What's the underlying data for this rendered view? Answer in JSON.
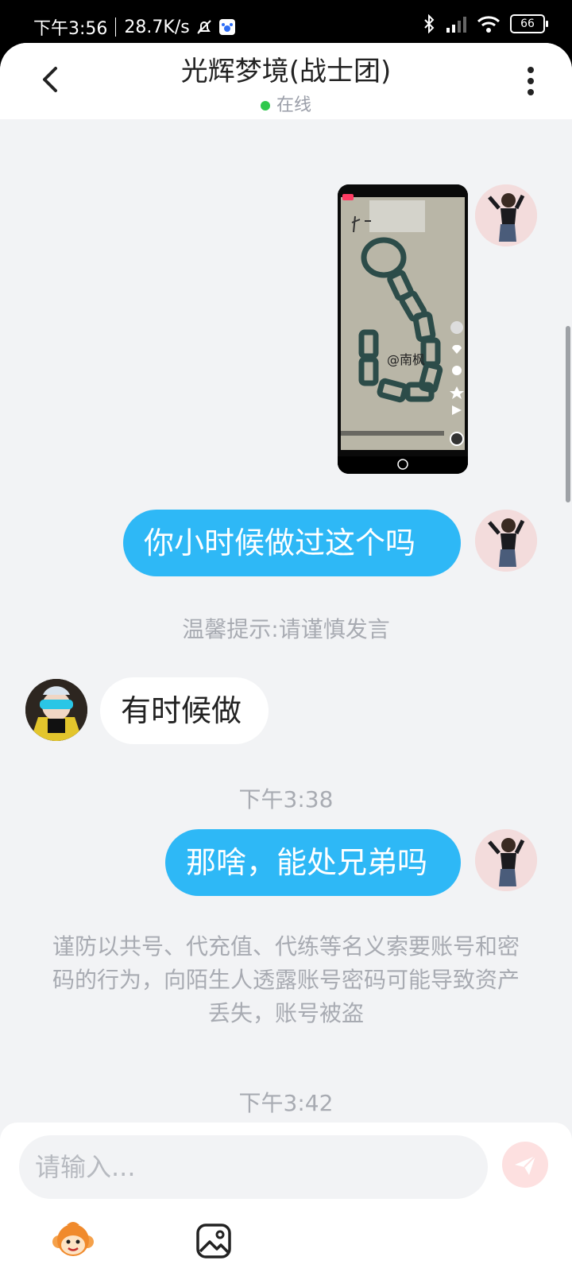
{
  "status_bar": {
    "time": "下午3:56",
    "speed": "28.7K/s",
    "battery": "66"
  },
  "header": {
    "title": "光辉梦境(战士团)",
    "status": "在线"
  },
  "messages": {
    "video_caption_user": "@一棵南枫",
    "msg1": "你小时候做过这个吗",
    "tip1": "温馨提示:请谨慎发言",
    "msg2": "有时候做",
    "time1": "下午3:38",
    "msg3": "那啥，能处兄弟吗",
    "notice": "谨防以共号、代充值、代练等名义索要账号和密码的行为，向陌生人透露账号密码可能导致资产丢失，账号被盗",
    "time2": "下午3:42"
  },
  "composer": {
    "placeholder": "请输入..."
  },
  "colors": {
    "bubble_me": "#2eb8f6",
    "online_dot": "#2fc84c",
    "send_disabled": "#fde0e0"
  }
}
